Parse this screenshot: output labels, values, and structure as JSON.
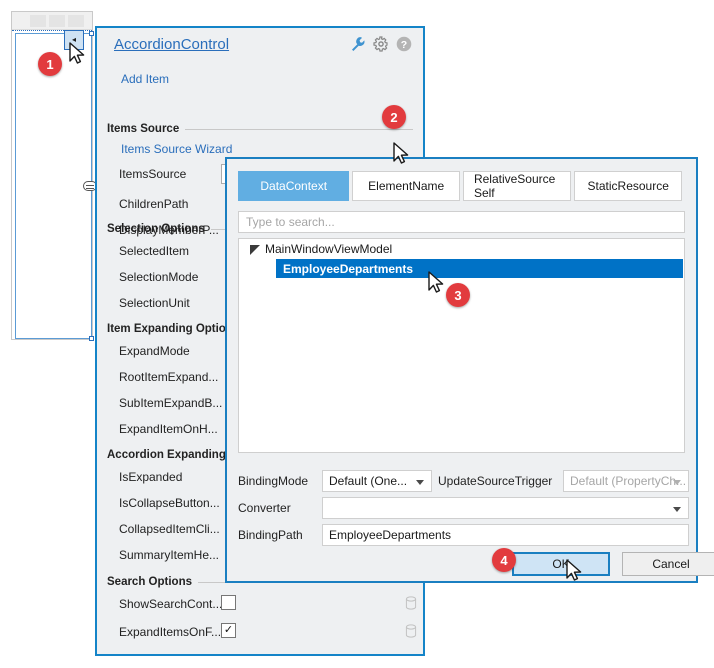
{
  "colors": {
    "accent_blue": "#1484c8",
    "link_blue": "#2a6ebb",
    "tab_active": "#61aee2",
    "tree_selection": "#0072c6",
    "marker_red": "#e23b3e",
    "panel_bg": "#eef0f2",
    "primary_button_fill": "#cfe4f5"
  },
  "designer": {
    "collapse_button_glyph": "◂"
  },
  "properties_panel": {
    "title": "AccordionControl",
    "header_icons": [
      {
        "name": "wrench-icon",
        "label": "Events"
      },
      {
        "name": "gear-icon",
        "label": "Settings"
      },
      {
        "name": "help-icon",
        "label": "Help"
      }
    ],
    "add_item_label": "Add Item",
    "sections": [
      {
        "header": "Items Source",
        "link": "Items Source Wizard",
        "rows": [
          {
            "label": "ItemsSource",
            "editor": "textbox",
            "value": "",
            "picker": "active"
          },
          {
            "label": "ChildrenPath",
            "editor": "none"
          },
          {
            "label": "DisplayMemberP...",
            "editor": "none"
          }
        ]
      },
      {
        "header": "Selection Options",
        "rows": [
          {
            "label": "SelectedItem",
            "editor": "none"
          },
          {
            "label": "SelectionMode",
            "editor": "none"
          },
          {
            "label": "SelectionUnit",
            "editor": "none"
          }
        ]
      },
      {
        "header": "Item Expanding Options",
        "rows": [
          {
            "label": "ExpandMode",
            "editor": "none"
          },
          {
            "label": "RootItemExpand...",
            "editor": "none"
          },
          {
            "label": "SubItemExpandB...",
            "editor": "none"
          },
          {
            "label": "ExpandItemOnH...",
            "editor": "none"
          }
        ]
      },
      {
        "header": "Accordion Expanding Options",
        "rows": [
          {
            "label": "IsExpanded",
            "editor": "none"
          },
          {
            "label": "IsCollapseButton...",
            "editor": "none"
          },
          {
            "label": "CollapsedItemCli...",
            "editor": "none"
          },
          {
            "label": "SummaryItemHe...",
            "editor": "none"
          }
        ]
      },
      {
        "header": "Search Options",
        "rows": [
          {
            "label": "ShowSearchCont...",
            "editor": "checkbox",
            "checked": false,
            "picker": "inactive"
          },
          {
            "label": "ExpandItemsOnF...",
            "editor": "checkbox",
            "checked": true,
            "picker": "inactive"
          }
        ]
      }
    ]
  },
  "binding_dialog": {
    "tabs": [
      {
        "label": "DataContext",
        "active": true
      },
      {
        "label": "ElementName",
        "active": false
      },
      {
        "label": "RelativeSource Self",
        "active": false
      },
      {
        "label": "StaticResource",
        "active": false
      }
    ],
    "search_placeholder": "Type to search...",
    "tree": {
      "root_label": "MainWindowViewModel",
      "selected_child_label": "EmployeeDepartments"
    },
    "fields": {
      "binding_mode_label": "BindingMode",
      "binding_mode_value": "Default (One...",
      "update_source_trigger_label": "UpdateSourceTrigger",
      "update_source_trigger_value": "Default (PropertyCh...",
      "converter_label": "Converter",
      "converter_value": "",
      "binding_path_label": "BindingPath",
      "binding_path_value": "EmployeeDepartments"
    },
    "buttons": {
      "ok": "OK",
      "cancel": "Cancel"
    }
  },
  "markers": [
    {
      "number": "1"
    },
    {
      "number": "2"
    },
    {
      "number": "3"
    },
    {
      "number": "4"
    }
  ]
}
